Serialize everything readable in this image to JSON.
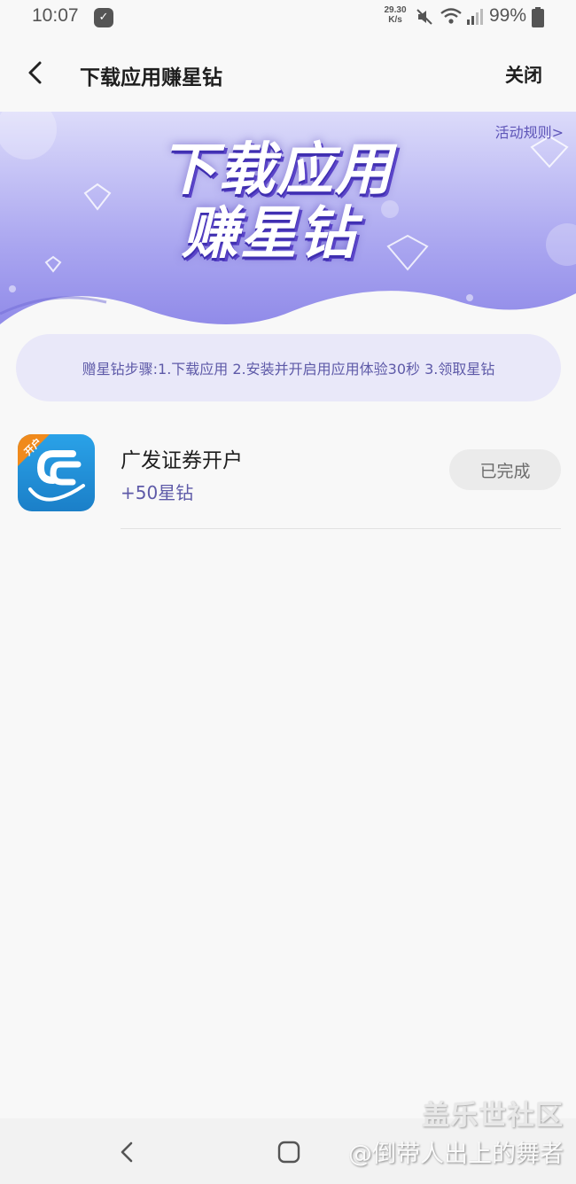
{
  "status_bar": {
    "time": "10:07",
    "net_speed_value": "29.30",
    "net_speed_unit": "K/s",
    "battery": "99%",
    "icons": [
      "app-notification-icon",
      "mute-icon",
      "wifi-icon",
      "signal-icon",
      "battery-icon"
    ]
  },
  "header": {
    "title": "下载应用赚星钻",
    "close_label": "关闭"
  },
  "banner": {
    "line1": "下载应用",
    "line2": "赚星钻",
    "rules_link": "活动规则>"
  },
  "steps_text": "赠星钻步骤:1.下载应用 2.安装并开启用应用体验30秒 3.领取星钻",
  "apps": [
    {
      "badge": "开户",
      "name": "广发证券开户",
      "reward": "+50星钻",
      "status": "已完成"
    }
  ],
  "watermark": {
    "line1": "盖乐世社区",
    "line2": "@倒带人出上的舞者"
  },
  "colors": {
    "accent": "#5e5aa8",
    "banner_purple": "#8b86e8",
    "steps_bg": "#e9e8f9"
  }
}
